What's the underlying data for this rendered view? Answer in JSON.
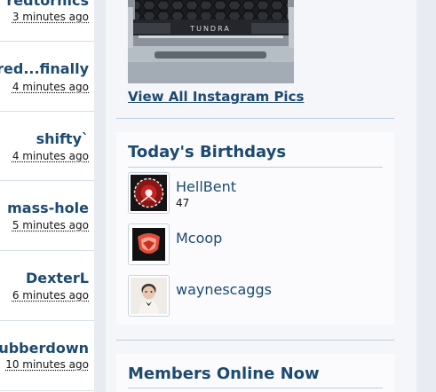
{
  "recent_activity": [
    {
      "user": "redtornics",
      "time": "3 minutes ago"
    },
    {
      "user": "red...finally",
      "time": "4 minutes ago"
    },
    {
      "user": "shifty`",
      "time": "4 minutes ago"
    },
    {
      "user": "mass-hole",
      "time": "5 minutes ago"
    },
    {
      "user": "DexterL",
      "time": "6 minutes ago"
    },
    {
      "user": "Rubberdown",
      "time": "10 minutes ago"
    }
  ],
  "instagram": {
    "image_brand_text": "TUNDRA",
    "view_all_label": "View All Instagram Pics"
  },
  "birthdays": {
    "title": "Today's Birthdays",
    "people": [
      {
        "name": "HellBent",
        "age": "47",
        "avatar": "red-gear-emblem-icon"
      },
      {
        "name": "Mcoop",
        "age": "",
        "avatar": "red-shield-logo-icon"
      },
      {
        "name": "waynescaggs",
        "age": "",
        "avatar": "child-photo-icon"
      }
    ]
  },
  "members_online": {
    "title": "Members Online Now"
  },
  "colors": {
    "link": "#1d4a70",
    "divider": "#bcd0dc",
    "sidebar_bg": "#f5f6fa"
  }
}
